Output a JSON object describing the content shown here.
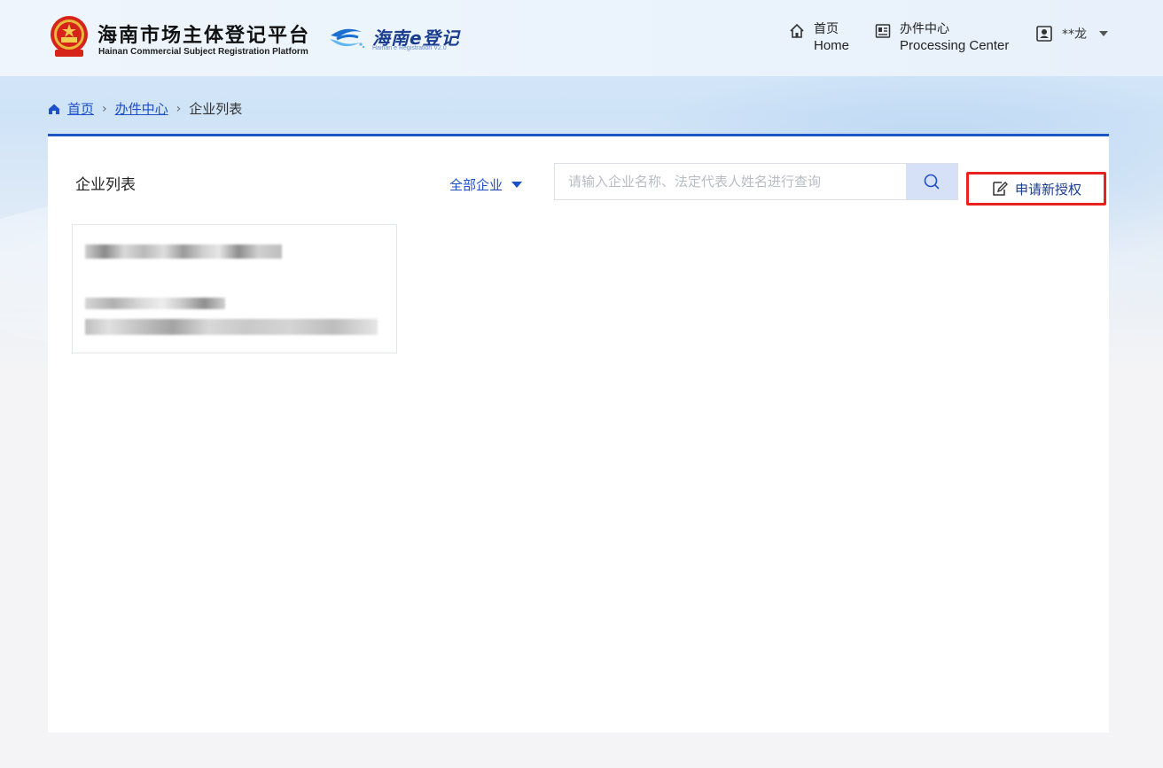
{
  "header": {
    "brand_cn": "海南市场主体登记平台",
    "brand_en": "Hainan Commercial Subject Registration Platform",
    "ereg_title": "海南e登记",
    "ereg_sub": "Hainan e Registration V2.0",
    "nav": [
      {
        "cn": "首页",
        "en": "Home",
        "icon": "home-icon"
      },
      {
        "cn": "办件中心",
        "en": "Processing Center",
        "icon": "processing-center-icon"
      }
    ],
    "user": {
      "name": "**龙",
      "icon": "user-card-icon"
    }
  },
  "breadcrumb": {
    "home": "首页",
    "center": "办件中心",
    "current": "企业列表"
  },
  "panel": {
    "title": "企业列表",
    "filter_label": "全部企业",
    "search_placeholder": "请输入企业名称、法定代表人姓名进行查询",
    "apply_button": "申请新授权"
  },
  "colors": {
    "accent": "#1e56c7",
    "link": "#1d4fc8",
    "highlight_border": "#e8231f",
    "search_button_bg": "#d6e0f7"
  }
}
